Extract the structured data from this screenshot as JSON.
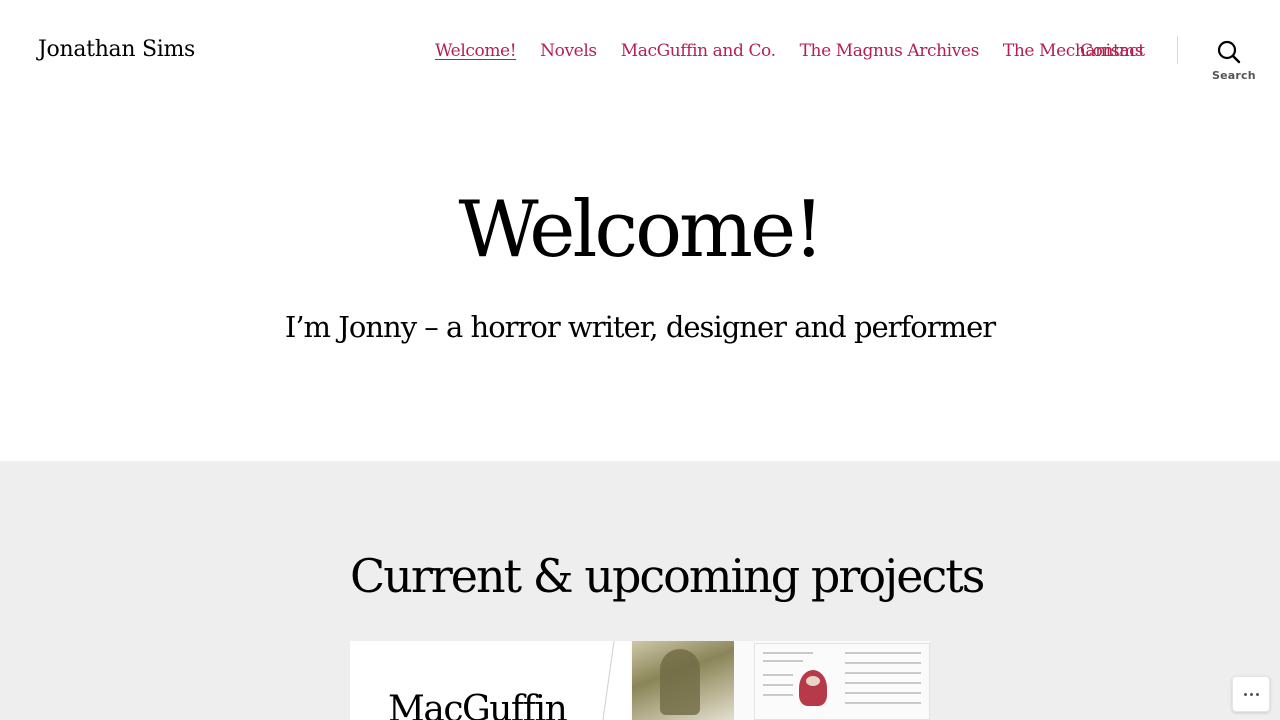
{
  "site": {
    "title": "Jonathan Sims"
  },
  "nav": {
    "items": [
      {
        "label": "Welcome!"
      },
      {
        "label": "Novels"
      },
      {
        "label": "MacGuffin and Co."
      },
      {
        "label": "The Magnus Archives"
      },
      {
        "label": "The Mechanisms"
      }
    ],
    "contact": "Contact"
  },
  "search": {
    "icon": "search-icon",
    "label": "Search"
  },
  "hero": {
    "title": "Welcome!",
    "tagline": "I’m Jonny – a horror writer, designer and performer"
  },
  "projects": {
    "heading": "Current & upcoming projects",
    "cover_title": "MacGuffin"
  },
  "more_button": {
    "icon": "ellipsis-icon"
  },
  "colors": {
    "link": "#b6204f",
    "projects_bg": "#eeeeee",
    "text": "#000000"
  }
}
